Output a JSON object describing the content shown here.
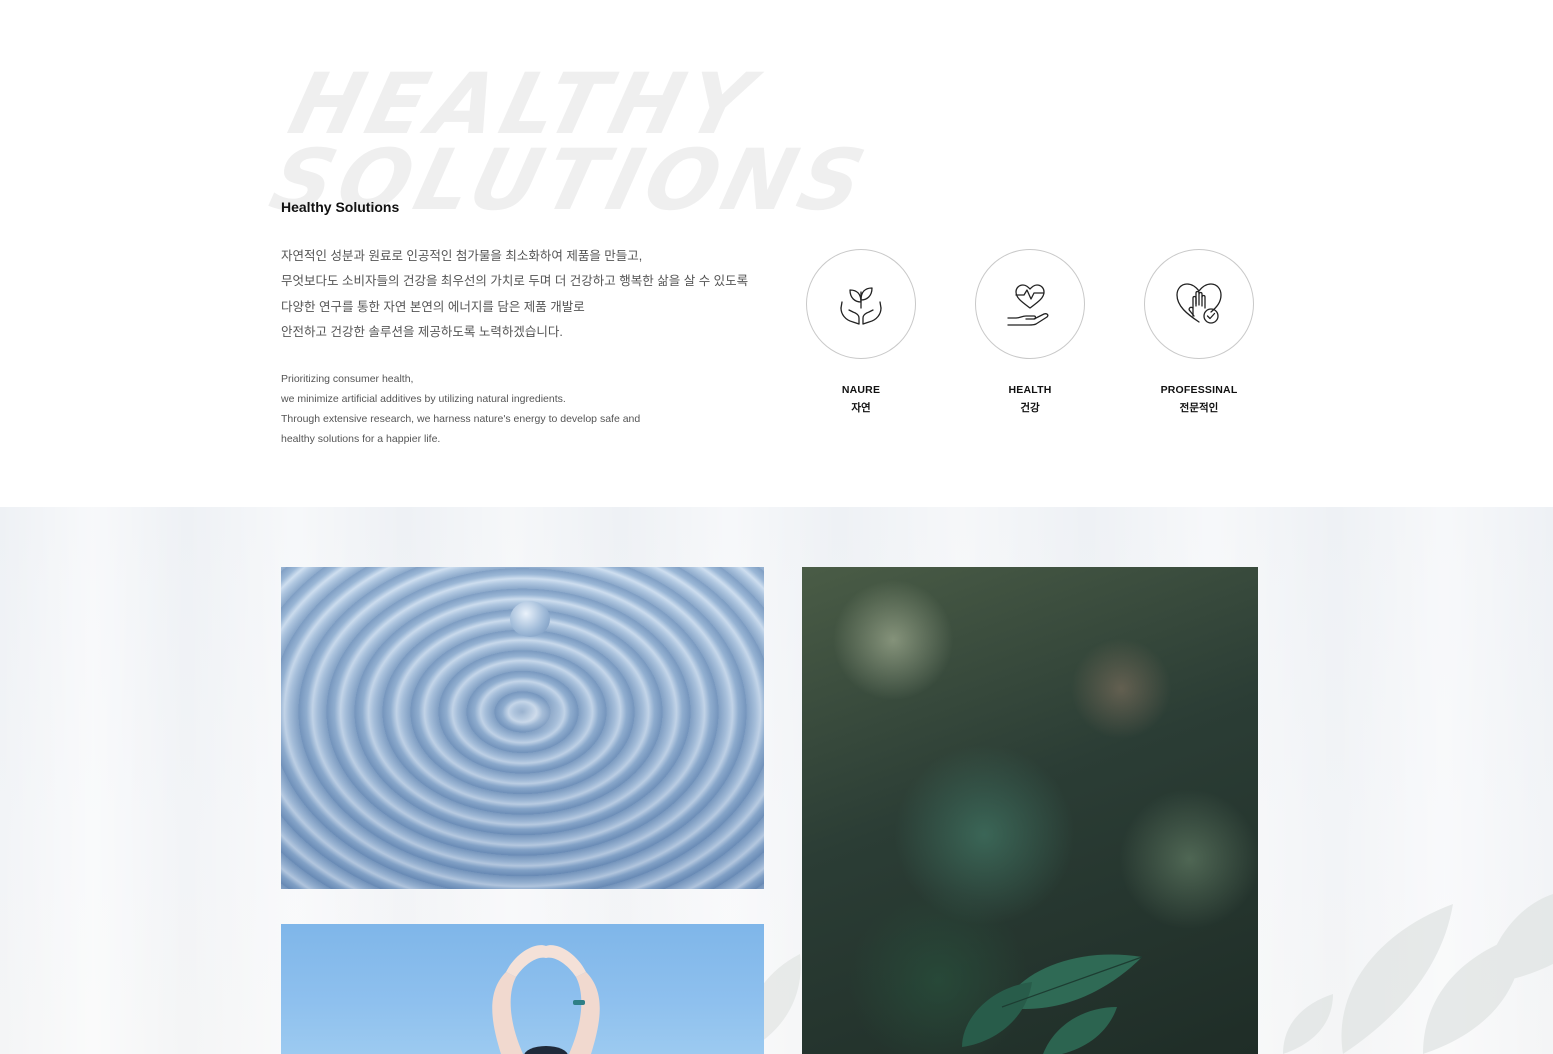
{
  "intro": {
    "watermark": "HEALTHY\nSOLUTIONS",
    "title": "Healthy Solutions",
    "ko_lines": [
      "자연적인 성분과 원료로 인공적인 첨가물을 최소화하여 제품을 만들고,",
      "무엇보다도 소비자들의 건강을  최우선의 가치로 두며 더 건강하고 행복한 삶을 살 수 있도록",
      "다양한 연구를 통한 자연 본연의 에너지를 담은 제품 개발로",
      "안전하고 건강한 솔루션을 제공하도록 노력하겠습니다."
    ],
    "en_lines": [
      "Prioritizing consumer health,",
      "we minimize artificial additives by utilizing natural ingredients.",
      "Through extensive research, we harness nature's energy to develop safe and",
      "healthy solutions for a happier life."
    ]
  },
  "features": [
    {
      "icon": "hands-leaf-icon",
      "label_en": "NAURE",
      "label_ko": "자연"
    },
    {
      "icon": "hand-heart-pulse-icon",
      "label_en": "HEALTH",
      "label_ko": "건강"
    },
    {
      "icon": "heart-hand-check-icon",
      "label_en": "PROFESSINAL",
      "label_ko": "전문적인"
    }
  ],
  "gallery": {
    "photos": [
      "water-drop-photo",
      "green-leaves-photo",
      "raised-arms-sky-photo"
    ]
  },
  "colors": {
    "watermark": "#efefef",
    "text": "#555555",
    "title": "#111111",
    "circle_border": "#c9c9c9",
    "gallery_bg": "#eef1f5"
  }
}
